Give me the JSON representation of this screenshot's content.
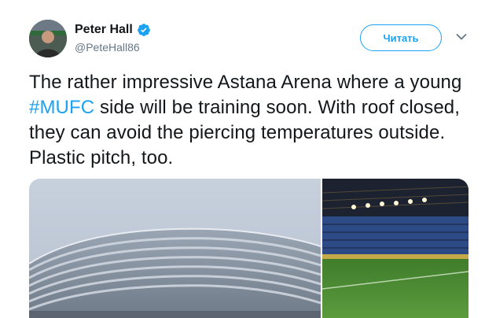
{
  "author": {
    "display_name": "Peter Hall",
    "handle": "@PeteHall86",
    "verified": true,
    "avatar_icon": "person-in-stadium-avatar"
  },
  "actions": {
    "follow_label": "Читать",
    "more_icon": "chevron-down-icon"
  },
  "tweet": {
    "text_before": "The rather impressive Astana Arena where a young ",
    "hashtag": "#MUFC",
    "text_after": " side will be training soon. With roof closed, they can avoid the piercing temperatures outside. Plastic pitch, too."
  },
  "media": {
    "photos": [
      {
        "name": "astana-arena-exterior-photo"
      },
      {
        "name": "astana-arena-interior-pitch-photo"
      }
    ]
  },
  "colors": {
    "accent": "#1da1f2",
    "text": "#14171a",
    "secondary_text": "#657786"
  }
}
